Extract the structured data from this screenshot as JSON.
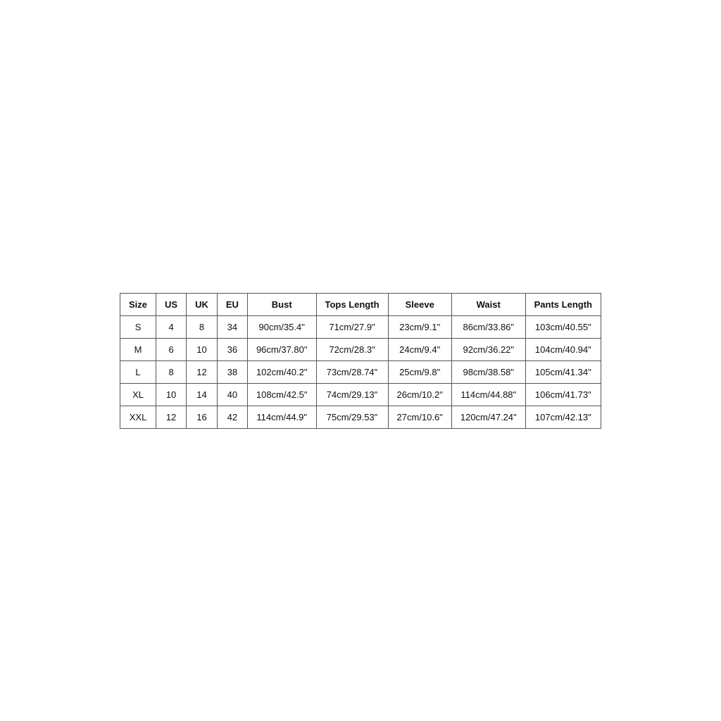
{
  "table": {
    "headers": [
      "Size",
      "US",
      "UK",
      "EU",
      "Bust",
      "Tops Length",
      "Sleeve",
      "Waist",
      "Pants Length"
    ],
    "rows": [
      {
        "size": "S",
        "us": "4",
        "uk": "8",
        "eu": "34",
        "bust": "90cm/35.4\"",
        "tops_length": "71cm/27.9\"",
        "sleeve": "23cm/9.1\"",
        "waist": "86cm/33.86\"",
        "pants_length": "103cm/40.55\""
      },
      {
        "size": "M",
        "us": "6",
        "uk": "10",
        "eu": "36",
        "bust": "96cm/37.80\"",
        "tops_length": "72cm/28.3\"",
        "sleeve": "24cm/9.4\"",
        "waist": "92cm/36.22\"",
        "pants_length": "104cm/40.94\""
      },
      {
        "size": "L",
        "us": "8",
        "uk": "12",
        "eu": "38",
        "bust": "102cm/40.2\"",
        "tops_length": "73cm/28.74\"",
        "sleeve": "25cm/9.8\"",
        "waist": "98cm/38.58\"",
        "pants_length": "105cm/41.34\""
      },
      {
        "size": "XL",
        "us": "10",
        "uk": "14",
        "eu": "40",
        "bust": "108cm/42.5\"",
        "tops_length": "74cm/29.13\"",
        "sleeve": "26cm/10.2\"",
        "waist": "114cm/44.88\"",
        "pants_length": "106cm/41.73\""
      },
      {
        "size": "XXL",
        "us": "12",
        "uk": "16",
        "eu": "42",
        "bust": "114cm/44.9\"",
        "tops_length": "75cm/29.53\"",
        "sleeve": "27cm/10.6\"",
        "waist": "120cm/47.24\"",
        "pants_length": "107cm/42.13\""
      }
    ]
  }
}
